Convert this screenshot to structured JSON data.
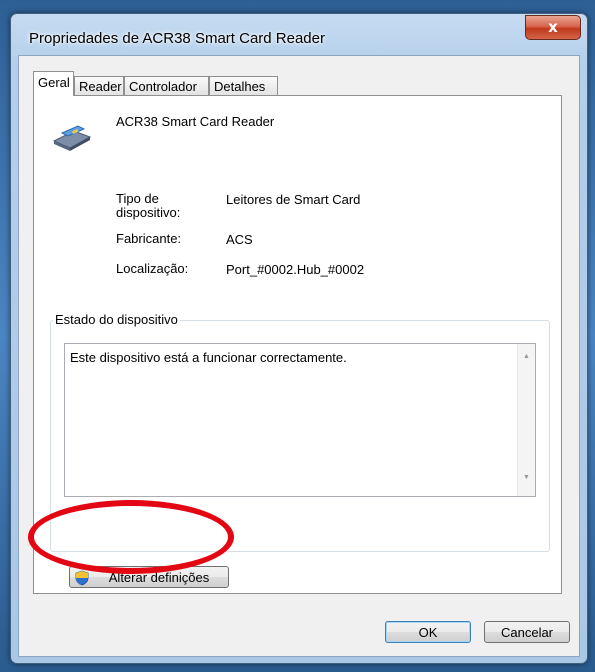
{
  "window": {
    "title": "Propriedades de ACR38 Smart Card Reader",
    "close_label": "x"
  },
  "tabs": [
    {
      "label": "Geral"
    },
    {
      "label": "Reader"
    },
    {
      "label": "Controlador"
    },
    {
      "label": "Detalhes"
    }
  ],
  "device": {
    "name": "ACR38 Smart Card Reader",
    "icon": "smart-card-reader-icon",
    "props": [
      {
        "label": "Tipo de dispositivo:",
        "value": "Leitores de Smart Card"
      },
      {
        "label": "Fabricante:",
        "value": "ACS"
      },
      {
        "label": "Localização:",
        "value": "Port_#0002.Hub_#0002"
      }
    ]
  },
  "status": {
    "group_title": "Estado do dispositivo",
    "text": "Este dispositivo está a funcionar correctamente."
  },
  "change_settings": {
    "label": "Alterar definições",
    "icon": "uac-shield-icon"
  },
  "footer": {
    "ok_label": "OK",
    "cancel_label": "Cancelar"
  },
  "colors": {
    "highlight_circle": "#e30613",
    "close_button": "#c0381b"
  }
}
